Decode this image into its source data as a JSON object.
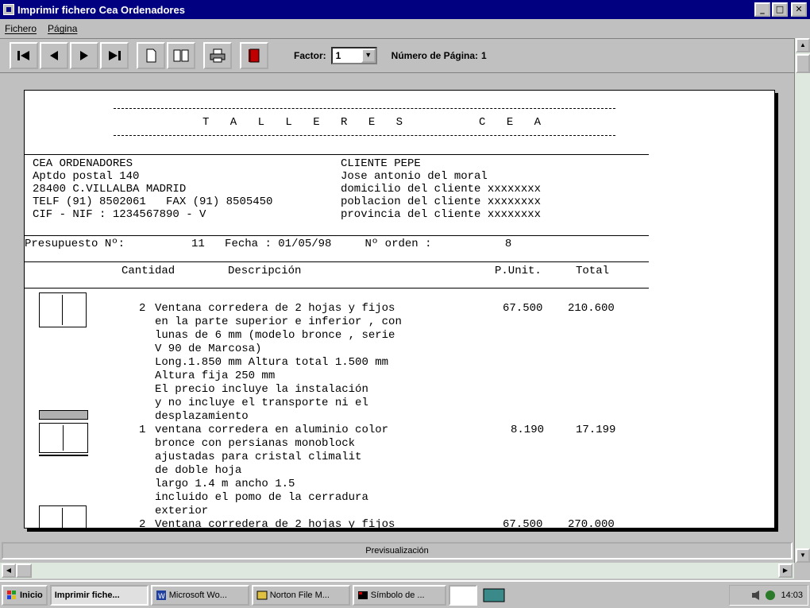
{
  "window": {
    "title": "Imprimir fichero Cea Ordenadores",
    "buttons": [
      "_",
      "□",
      "✕"
    ]
  },
  "menu": {
    "items": [
      "Fichero",
      "Página"
    ]
  },
  "toolbar": {
    "factor_label": "Factor:",
    "factor_value": "1",
    "page_label": "Número de Página:",
    "page_value": "1"
  },
  "document": {
    "title": "T A L L E R E S     C E A",
    "company": [
      "CEA ORDENADORES",
      "Aptdo postal 140",
      "28400 C.VILLALBA MADRID",
      "TELF (91) 8502061   FAX (91) 8505450",
      "CIF - NIF : 1234567890 - V"
    ],
    "client": [
      "CLIENTE PEPE",
      "Jose antonio del moral",
      "domicilio del cliente xxxxxxxx",
      "poblacion del cliente xxxxxxxx",
      "provincia del cliente xxxxxxxx"
    ],
    "meta_line": "Presupuesto Nº:          11   Fecha : 01/05/98     Nº orden :           8",
    "columns": {
      "cantidad": "Cantidad",
      "descripcion": "Descripción",
      "punit": "P.Unit.",
      "total": "Total"
    },
    "items": [
      {
        "qty": "2",
        "lines": [
          "Ventana corredera de 2 hojas y fijos",
          "en la parte superior e inferior , con",
          "lunas de 6 mm (modelo bronce , serie",
          "V 90 de Marcosa)",
          "Long.1.850 mm Altura total 1.500 mm",
          "Altura fija 250 mm",
          "El precio incluye la instalación",
          "y no incluye el transporte ni el",
          "desplazamiento"
        ],
        "punit": "67.500",
        "total": "210.600"
      },
      {
        "qty": "1",
        "lines": [
          "ventana corredera en aluminio color",
          "bronce con persianas monoblock",
          "ajustadas para cristal climalit",
          "de doble hoja",
          "largo 1.4 m ancho 1.5",
          "incluido el pomo de la cerradura",
          "exterior"
        ],
        "punit": "8.190",
        "total": "17.199"
      },
      {
        "qty": "2",
        "lines": [
          "Ventana corredera de 2 hojas y fijos"
        ],
        "punit": "67.500",
        "total": "270.000"
      }
    ]
  },
  "status_text": "Previsualización",
  "taskbar": {
    "start": "Inicio",
    "tasks": [
      "Imprimir fiche...",
      "Microsoft Wo...",
      "Norton File M...",
      "Símbolo de ..."
    ],
    "clock": "14:03"
  },
  "colors": {
    "titlebar": "#000080",
    "chrome": "#c0c0c0",
    "paper": "#ffffff"
  }
}
